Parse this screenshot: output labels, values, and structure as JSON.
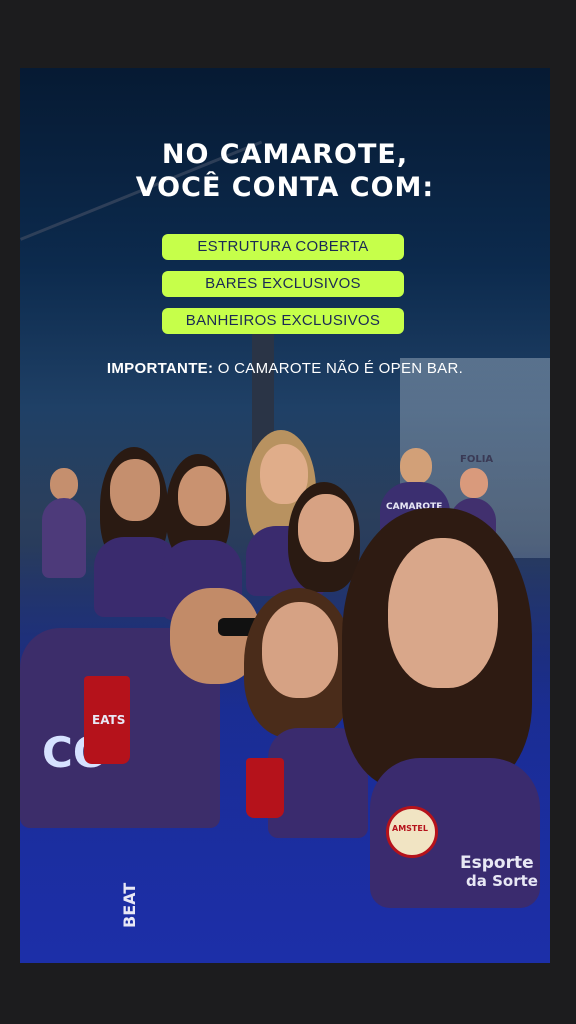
{
  "headline": {
    "line1": "NO CAMAROTE,",
    "line2": "VOCÊ CONTA COM:"
  },
  "features": [
    "ESTRUTURA COBERTA",
    "BARES EXCLUSIVOS",
    "BANHEIROS EXCLUSIVOS"
  ],
  "notice": {
    "label": "IMPORTANTE:",
    "text": " O CAMAROTE  NÃO É OPEN BAR."
  },
  "photo_text": {
    "cup_logo": "EATS",
    "shirt_left": "CO",
    "badge": "AMSTEL",
    "sponsor_line1": "Esporte",
    "sponsor_line2": "da Sorte",
    "back_shirt": "CAMAROTE",
    "sign": "FOLIA",
    "bottom_shirt": "BEAT"
  },
  "colors": {
    "pill_bg": "#c6ff4a",
    "pill_text": "#1b2a55",
    "background": "#1c1c1e"
  }
}
